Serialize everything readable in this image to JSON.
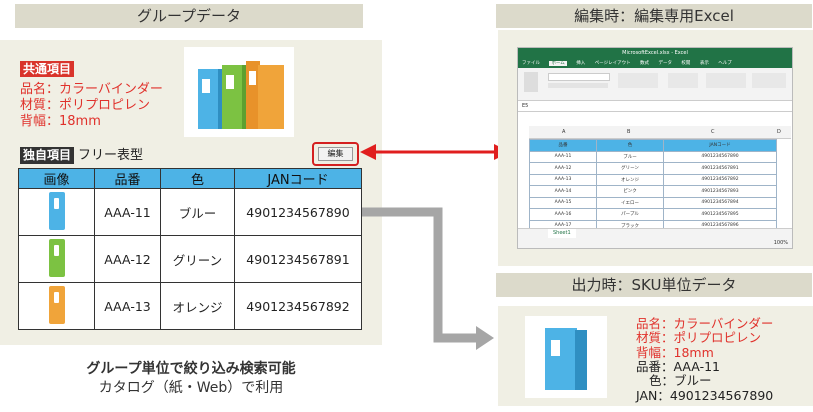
{
  "group": {
    "header": "グループデータ",
    "common_tag": "共通項目",
    "common_items": [
      "品名：カラーバインダー",
      "材質：ポリプロピレン",
      "背幅：18mm"
    ],
    "own_tag": "独自項目",
    "own_label": "フリー表型",
    "edit_button": "編集",
    "table": {
      "headers": [
        "画像",
        "品番",
        "色",
        "JANコード"
      ],
      "rows": [
        {
          "code": "AAA-11",
          "color": "ブルー",
          "jan": "4901234567890",
          "swatch": "#4db3e6"
        },
        {
          "code": "AAA-12",
          "color": "グリーン",
          "jan": "4901234567891",
          "swatch": "#7cc242"
        },
        {
          "code": "AAA-13",
          "color": "オレンジ",
          "jan": "4901234567892",
          "swatch": "#f0a43a"
        }
      ]
    },
    "caption_bold": "グループ単位で絞り込み検索可能",
    "caption": "カタログ（紙・Web）で利用"
  },
  "edit": {
    "header": "編集時：編集専用Excel",
    "excel": {
      "title": "MicrosoftExcel.xlsx - Excel",
      "tabs": [
        "ファイル",
        "ホーム",
        "挿入",
        "ページレイアウト",
        "数式",
        "データ",
        "校閲",
        "表示",
        "ヘルプ"
      ],
      "cell_ref": "E5",
      "columns": [
        "A",
        "B",
        "C",
        "D"
      ],
      "table_headers": [
        "品番",
        "色",
        "JANコード"
      ],
      "rows": [
        [
          "AAA-11",
          "ブルー",
          "4901234567890"
        ],
        [
          "AAA-12",
          "グリーン",
          "4901234567891"
        ],
        [
          "AAA-13",
          "オレンジ",
          "4901234567892"
        ],
        [
          "AAA-14",
          "ピンク",
          "4901234567893"
        ],
        [
          "AAA-15",
          "イエロー",
          "4901234567894"
        ],
        [
          "AAA-16",
          "パープル",
          "4901234567895"
        ],
        [
          "AAA-17",
          "ブラック",
          "4901234567896"
        ]
      ],
      "sheet": "Sheet1",
      "zoom": "100%"
    }
  },
  "output": {
    "header": "出力時：SKU単位データ",
    "lines_red": [
      "品名：カラーバインダー",
      "材質：ポリプロピレン",
      "背幅：18mm"
    ],
    "lines_black": [
      "品番：AAA-11",
      "色：ブルー",
      "JAN：4901234567890"
    ]
  },
  "colors": {
    "accent_blue": "#4db3e6",
    "red": "#e0312b",
    "arrow_red": "#e01e1e",
    "arrow_gray": "#a6a6a6"
  }
}
